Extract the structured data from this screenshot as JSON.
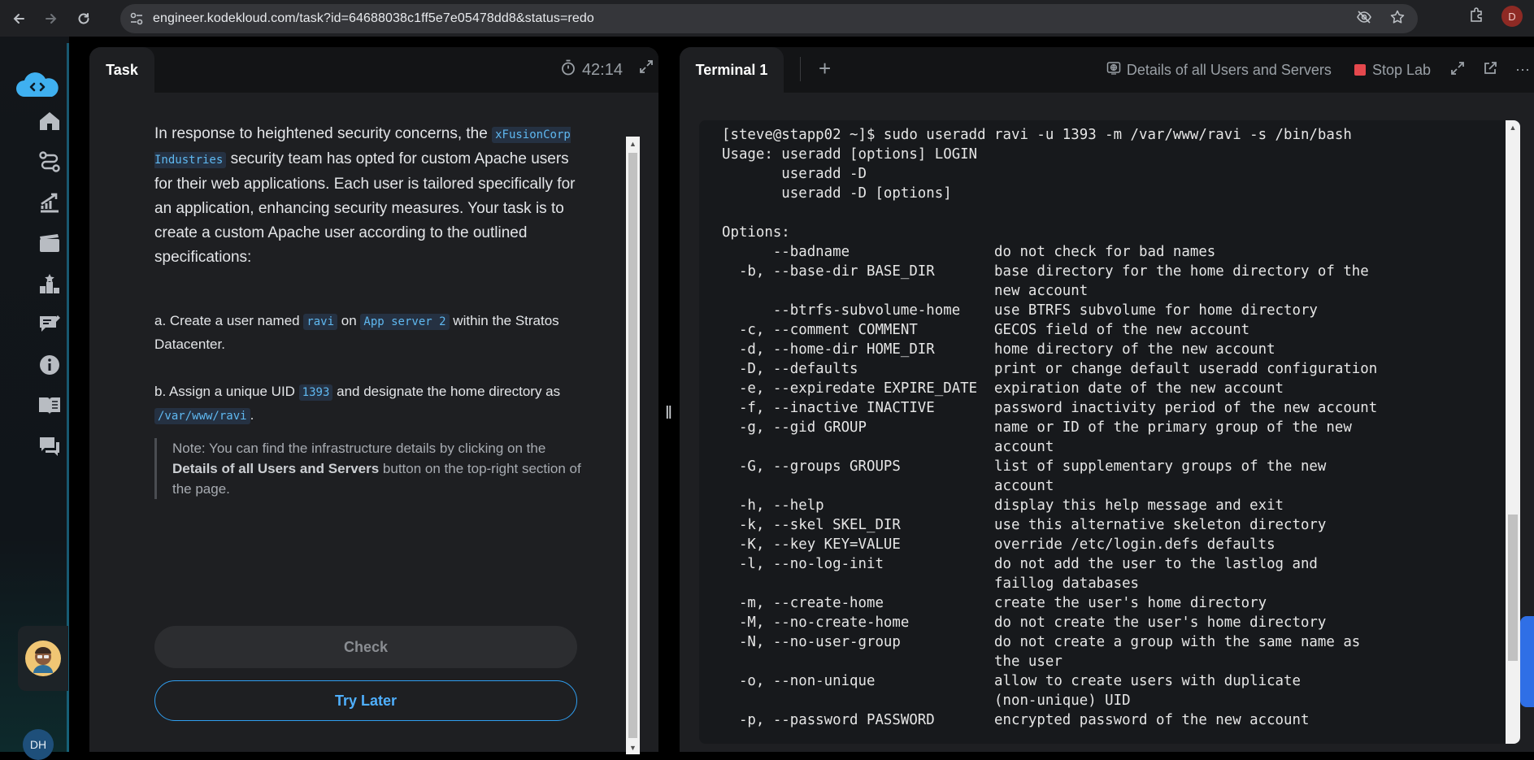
{
  "browser": {
    "url": "engineer.kodekloud.com/task?id=64688038c1ff5e7e05478dd8&status=redo",
    "profile_initial": "D"
  },
  "sidebar": {
    "items": [
      {
        "icon": "home-icon"
      },
      {
        "icon": "roadmap-icon"
      },
      {
        "icon": "progress-icon"
      },
      {
        "icon": "videos-icon"
      },
      {
        "icon": "leaderboard-icon"
      },
      {
        "icon": "tasks-icon"
      },
      {
        "icon": "info-icon"
      },
      {
        "icon": "docs-icon"
      },
      {
        "icon": "chat-icon"
      }
    ],
    "user_initials": "DH"
  },
  "task": {
    "tab_label": "Task",
    "timer": "42:14",
    "intro_1": "In response to heightened security concerns, the ",
    "company": "xFusionCorp Industries",
    "intro_2": " security team has opted for custom Apache users for their web applications. Each user is tailored specifically for an application, enhancing security measures. Your task is to create a custom Apache user according to the outlined specifications:",
    "a_1": "a. Create a user named ",
    "a_user": "ravi",
    "a_2": " on ",
    "a_server": "App server 2",
    "a_3": " within the Stratos Datacenter.",
    "b_1": "b. Assign a unique UID ",
    "b_uid": "1393",
    "b_2": " and designate the home directory as ",
    "b_dir": "/var/www/ravi",
    "b_3": ".",
    "note_1": "Note: You can find the infrastructure details by clicking on the ",
    "note_bold": "Details of all Users and Servers",
    "note_2": " button on the top-right section of the page.",
    "check_label": "Check",
    "later_label": "Try Later"
  },
  "terminal": {
    "tab_label": "Terminal 1",
    "details_label": "Details of all Users and Servers",
    "stop_label": "Stop Lab",
    "lines": [
      "[steve@stapp02 ~]$ sudo useradd ravi -u 1393 -m /var/www/ravi -s /bin/bash",
      "Usage: useradd [options] LOGIN",
      "       useradd -D",
      "       useradd -D [options]",
      "",
      "Options:",
      "      --badname                 do not check for bad names",
      "  -b, --base-dir BASE_DIR       base directory for the home directory of the",
      "                                new account",
      "      --btrfs-subvolume-home    use BTRFS subvolume for home directory",
      "  -c, --comment COMMENT         GECOS field of the new account",
      "  -d, --home-dir HOME_DIR       home directory of the new account",
      "  -D, --defaults                print or change default useradd configuration",
      "  -e, --expiredate EXPIRE_DATE  expiration date of the new account",
      "  -f, --inactive INACTIVE       password inactivity period of the new account",
      "  -g, --gid GROUP               name or ID of the primary group of the new",
      "                                account",
      "  -G, --groups GROUPS           list of supplementary groups of the new",
      "                                account",
      "  -h, --help                    display this help message and exit",
      "  -k, --skel SKEL_DIR           use this alternative skeleton directory",
      "  -K, --key KEY=VALUE           override /etc/login.defs defaults",
      "  -l, --no-log-init             do not add the user to the lastlog and",
      "                                faillog databases",
      "  -m, --create-home             create the user's home directory",
      "  -M, --no-create-home          do not create the user's home directory",
      "  -N, --no-user-group           do not create a group with the same name as",
      "                                the user",
      "  -o, --non-unique              allow to create users with duplicate",
      "                                (non-unique) UID",
      "  -p, --password PASSWORD       encrypted password of the new account"
    ]
  }
}
